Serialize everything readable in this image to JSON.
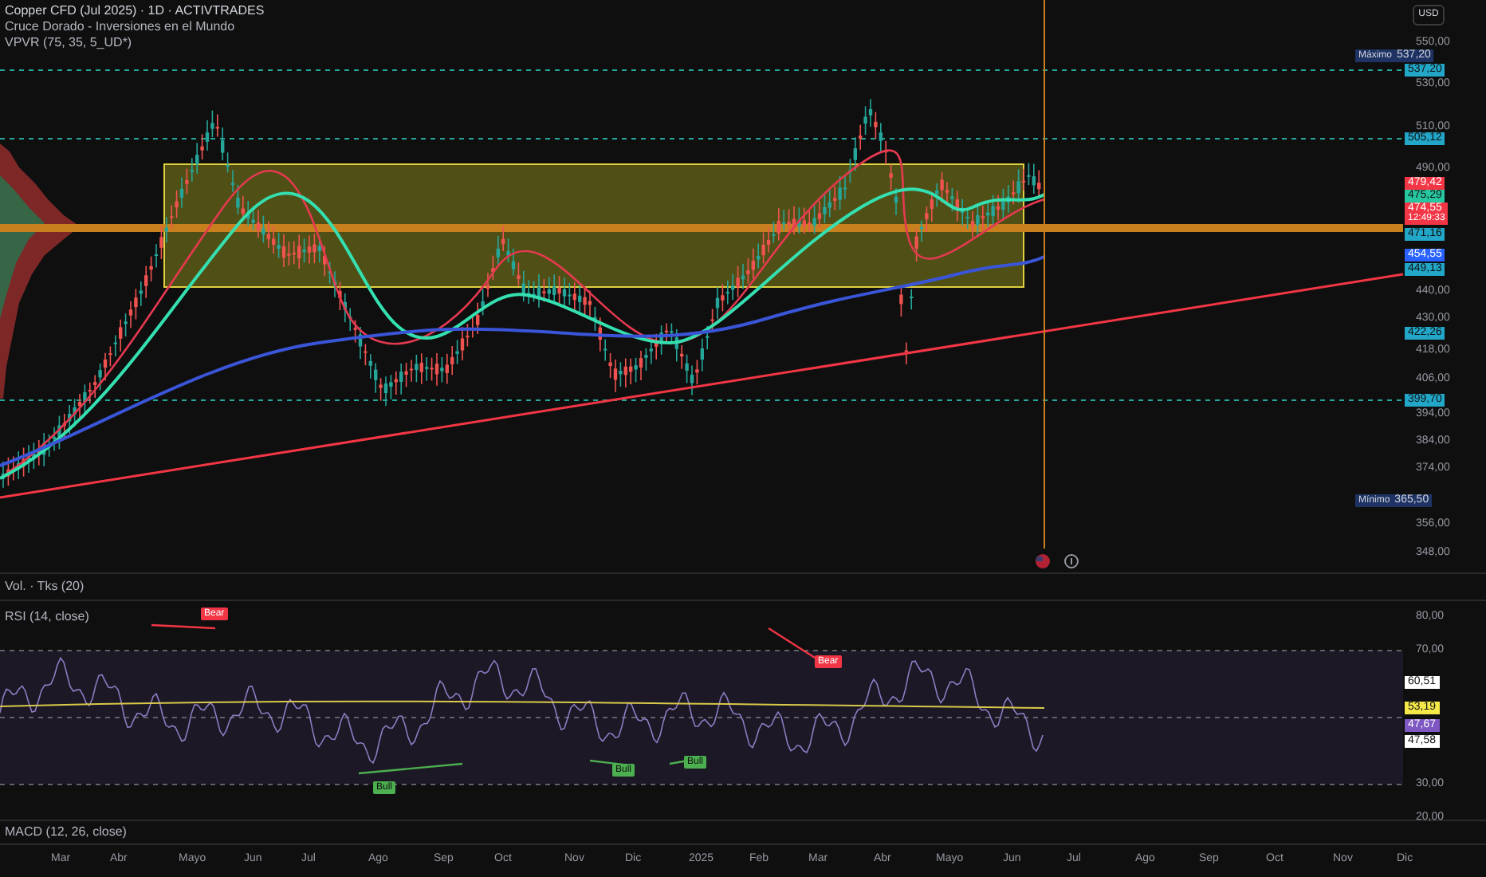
{
  "legend": [
    "Copper CFD (Jul 2025) · 1D · ACTIVTRADES",
    "Cruce Dorado - Inversiones en el Mundo",
    "VPVR (75, 35, 5_UD*)"
  ],
  "price_axis": {
    "currency": "USD",
    "labels": [
      {
        "kind": "tick",
        "value": "550,00"
      },
      {
        "kind": "extreme",
        "label": "Máximo",
        "value": "537,20"
      },
      {
        "kind": "tag",
        "value": "537,20",
        "color": "#22a7c9"
      },
      {
        "kind": "tick",
        "value": "530,00"
      },
      {
        "kind": "tick",
        "value": "510,00"
      },
      {
        "kind": "tag",
        "value": "505,12",
        "color": "#22a7c9"
      },
      {
        "kind": "tick",
        "value": "490,00"
      },
      {
        "kind": "tag",
        "value": "479,42",
        "color": "#f23645"
      },
      {
        "kind": "tag",
        "value": "475,29",
        "color": "#26c6a0"
      },
      {
        "kind": "current",
        "value": "474,55",
        "countdown": "12:49:33",
        "color": "#f23645"
      },
      {
        "kind": "tag",
        "value": "471,16",
        "color": "#22a7c9"
      },
      {
        "kind": "tag",
        "value": "454,55",
        "color": "#2962ff"
      },
      {
        "kind": "tag",
        "value": "449,13",
        "color": "#22a7c9"
      },
      {
        "kind": "tick",
        "value": "440,00"
      },
      {
        "kind": "tick",
        "value": "430,00"
      },
      {
        "kind": "tag",
        "value": "422,26",
        "color": "#22a7c9"
      },
      {
        "kind": "tick",
        "value": "418,00"
      },
      {
        "kind": "tick",
        "value": "406,00"
      },
      {
        "kind": "tag",
        "value": "399,70",
        "color": "#22a7c9"
      },
      {
        "kind": "tick",
        "value": "394,00"
      },
      {
        "kind": "tick",
        "value": "384,00"
      },
      {
        "kind": "tick",
        "value": "374,00"
      },
      {
        "kind": "extreme",
        "label": "Mínimo",
        "value": "365,50"
      },
      {
        "kind": "tick",
        "value": "356,00"
      },
      {
        "kind": "tick",
        "value": "348,00"
      }
    ]
  },
  "volume": {
    "title": "Vol. · Tks (20)"
  },
  "rsi": {
    "title": "RSI (14, close)",
    "signals": [
      {
        "text": "Bear",
        "kind": "bear"
      },
      {
        "text": "Bull",
        "kind": "bull"
      },
      {
        "text": "Bull",
        "kind": "bull"
      },
      {
        "text": "Bull",
        "kind": "bull"
      },
      {
        "text": "Bear",
        "kind": "bear"
      }
    ],
    "axis": [
      {
        "kind": "tick",
        "value": "80,00"
      },
      {
        "kind": "tick",
        "value": "70,00"
      },
      {
        "kind": "tag",
        "value": "60,51",
        "color": "#ffffff"
      },
      {
        "kind": "tag",
        "value": "53,19",
        "color": "#f5e94a"
      },
      {
        "kind": "tag",
        "value": "47,67",
        "color": "#7e57c2"
      },
      {
        "kind": "tag",
        "value": "47,58",
        "color": "#ffffff"
      },
      {
        "kind": "tick",
        "value": "30,00"
      },
      {
        "kind": "tick",
        "value": "20,00"
      }
    ]
  },
  "macd": {
    "title": "MACD (12, 26, close)"
  },
  "time_axis": [
    "Mar",
    "Abr",
    "Mayo",
    "Jun",
    "Jul",
    "Ago",
    "Sep",
    "Oct",
    "Nov",
    "Dic",
    "2025",
    "Feb",
    "Mar",
    "Abr",
    "Mayo",
    "Jun",
    "Jul",
    "Ago",
    "Sep",
    "Oct",
    "Nov",
    "Dic"
  ]
}
